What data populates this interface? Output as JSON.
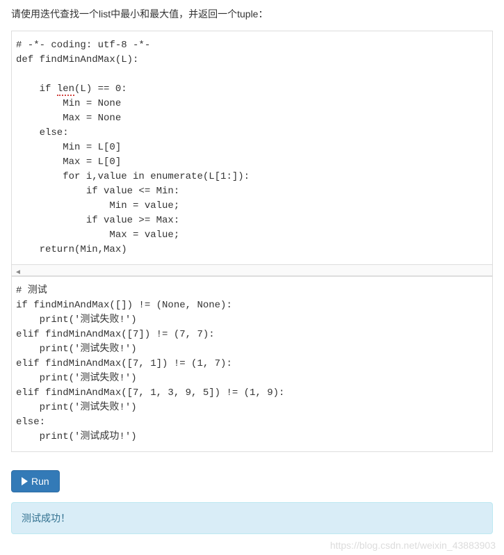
{
  "intro": "请使用迭代查找一个list中最小和最大值，并返回一个tuple：",
  "code_block_1": {
    "lines": [
      "# -*- coding: utf-8 -*-",
      "def findMinAndMax(L):",
      "",
      "    if len(L) == 0:",
      "        Min = None",
      "        Max = None",
      "    else:",
      "        Min = L[0]",
      "        Max = L[0]",
      "        for i,value in enumerate(L[1:]):",
      "            if value <= Min:",
      "                Min = value;",
      "            if value >= Max:",
      "                Max = value;",
      "    return(Min,Max)"
    ]
  },
  "code_block_2": {
    "lines": [
      "# 测试",
      "if findMinAndMax([]) != (None, None):",
      "    print('测试失败!')",
      "elif findMinAndMax([7]) != (7, 7):",
      "    print('测试失败!')",
      "elif findMinAndMax([7, 1]) != (1, 7):",
      "    print('测试失败!')",
      "elif findMinAndMax([7, 1, 3, 9, 5]) != (1, 9):",
      "    print('测试失败!')",
      "else:",
      "    print('测试成功!')"
    ]
  },
  "run_label": "Run",
  "output": "测试成功！",
  "watermark": "https://blog.csdn.net/weixin_43883903"
}
